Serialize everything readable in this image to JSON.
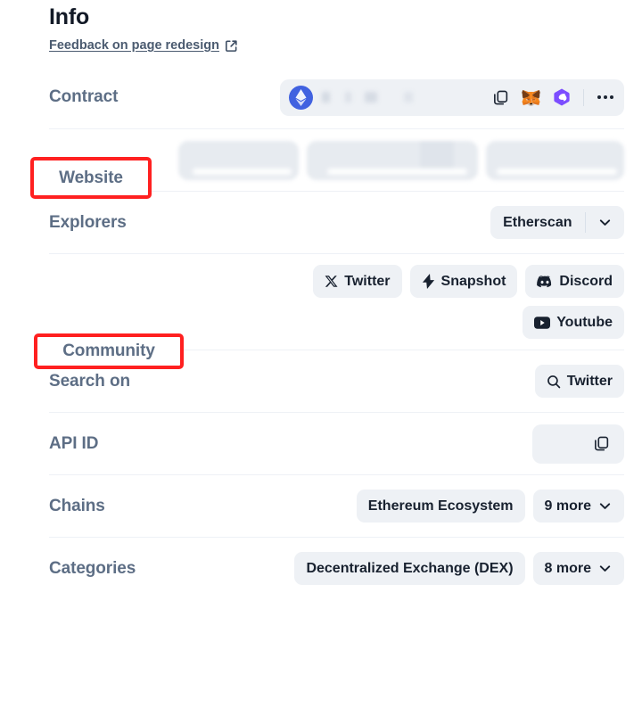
{
  "header": {
    "title": "Info",
    "feedback_link": "Feedback on page redesign",
    "external_link_icon": "external-link-icon"
  },
  "rows": {
    "contract": {
      "label": "Contract",
      "chain_icon": "ethereum-logo-icon",
      "address": "",
      "address_state": "blurred",
      "actions": [
        "copy-icon",
        "metamask-icon",
        "rabby-wallet-icon",
        "more-options-icon"
      ]
    },
    "website": {
      "label": "Website",
      "links_state": "blurred",
      "link_count": 3
    },
    "explorers": {
      "label": "Explorers",
      "selected": "Etherscan",
      "caret_icon": "chevron-down-icon"
    },
    "community": {
      "label": "Community",
      "chips": [
        {
          "label": "Twitter",
          "icon": "x-twitter-icon"
        },
        {
          "label": "Snapshot",
          "icon": "snapshot-bolt-icon"
        },
        {
          "label": "Discord",
          "icon": "discord-icon"
        },
        {
          "label": "Youtube",
          "icon": "youtube-icon"
        }
      ]
    },
    "search_on": {
      "label": "Search on",
      "chip": {
        "label": "Twitter",
        "icon": "search-icon"
      }
    },
    "api_id": {
      "label": "API ID",
      "value": "",
      "copy_icon": "copy-icon"
    },
    "chains": {
      "label": "Chains",
      "primary": "Ethereum Ecosystem",
      "more": "9 more",
      "caret_icon": "chevron-down-icon"
    },
    "categories": {
      "label": "Categories",
      "primary": "Decentralized Exchange (DEX)",
      "more": "8 more",
      "caret_icon": "chevron-down-icon"
    }
  },
  "annotations": [
    {
      "target": "Website",
      "color": "#ff2020"
    },
    {
      "target": "Community",
      "color": "#ff2020"
    }
  ],
  "colors": {
    "label": "#5d6e85",
    "chip_bg": "#eef1f5",
    "chip_text": "#18212f",
    "divider": "#eef1f6",
    "annotation": "#ff2020",
    "ethereum_blue": "#4162e0"
  }
}
